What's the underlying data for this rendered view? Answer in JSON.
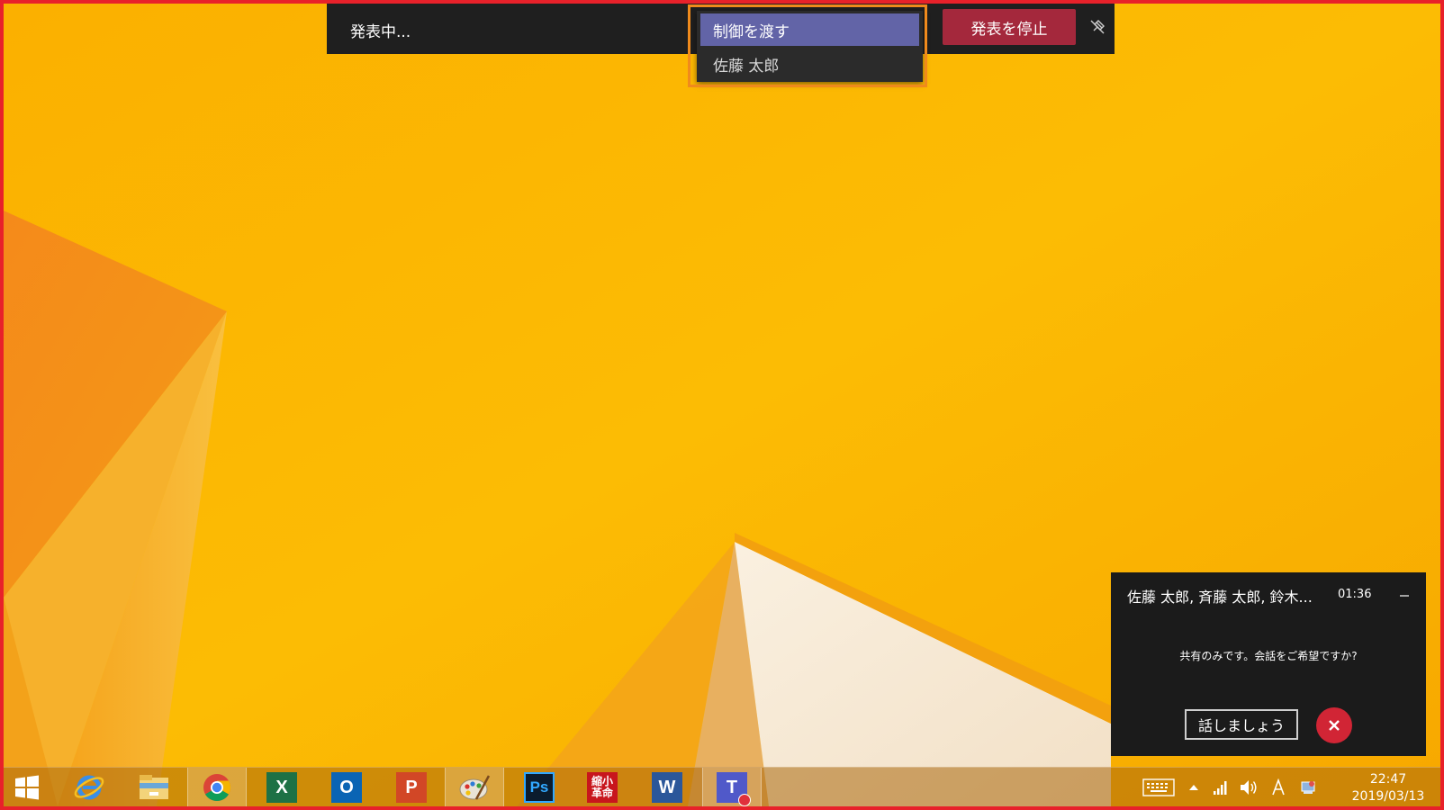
{
  "presenter_bar": {
    "status_label": "発表中...",
    "stop_button_label": "発表を停止",
    "unpin_icon": "unpin-icon"
  },
  "control_menu": {
    "header_label": "制御を渡す",
    "items": [
      {
        "label": "佐藤 太郎"
      }
    ]
  },
  "call_notification": {
    "participants": "佐藤 太郎, 斉藤 太郎, 鈴木...",
    "timer": "01:36",
    "message": "共有のみです。会話をご希望ですか?",
    "talk_button_label": "話しましょう",
    "decline_icon": "close-icon"
  },
  "taskbar": {
    "apps": [
      {
        "name": "start-button",
        "icon": "windows-logo-icon"
      },
      {
        "name": "internet-explorer",
        "icon": "ie-icon"
      },
      {
        "name": "file-explorer",
        "icon": "folder-icon"
      },
      {
        "name": "chrome",
        "icon": "chrome-icon"
      },
      {
        "name": "excel",
        "icon": "excel-icon",
        "letter": "X"
      },
      {
        "name": "outlook",
        "icon": "outlook-icon",
        "letter": "O"
      },
      {
        "name": "powerpoint",
        "icon": "powerpoint-icon",
        "letter": "P"
      },
      {
        "name": "paint",
        "icon": "palette-icon"
      },
      {
        "name": "photoshop",
        "icon": "photoshop-icon",
        "letter": "Ps"
      },
      {
        "name": "shrink-app",
        "icon": "shrink-app-icon",
        "letter": "縮小革命"
      },
      {
        "name": "word",
        "icon": "word-icon",
        "letter": "W"
      },
      {
        "name": "teams",
        "icon": "teams-icon",
        "letter": "T"
      }
    ],
    "clock": {
      "time": "22:47",
      "date": "2019/03/13"
    }
  },
  "colors": {
    "accent_purple": "#6264a7",
    "stop_red": "#a4283c",
    "decline_red": "#d12535",
    "highlight_orange": "#f08a1c",
    "frame_red": "#e8212a"
  }
}
